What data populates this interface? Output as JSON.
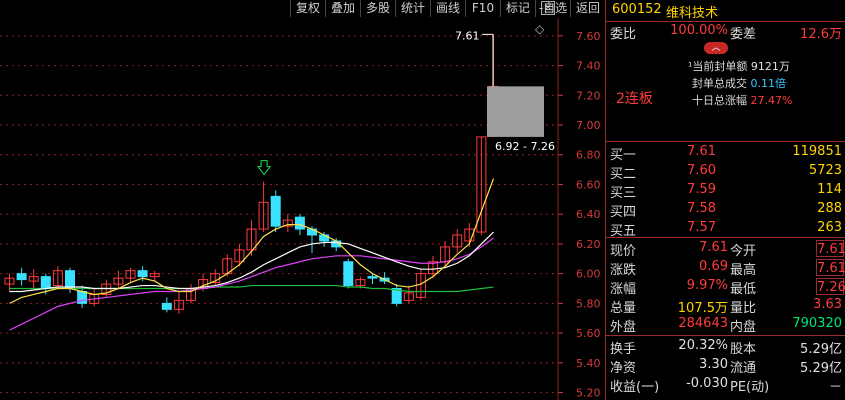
{
  "toolbar": {
    "buttons": [
      "复权",
      "叠加",
      "多股",
      "统计",
      "画线",
      "F10",
      "标记",
      "-自选",
      "返回"
    ],
    "close_symbol": "×"
  },
  "axis": {
    "ticks": [
      "7.60",
      "7.40",
      "7.20",
      "7.00",
      "6.80",
      "6.60",
      "6.40",
      "6.20",
      "6.00",
      "5.80",
      "5.60",
      "5.40",
      "5.20"
    ],
    "range": [
      5.15,
      7.72
    ]
  },
  "annotations": {
    "high_label": "7.61",
    "range_label": "6.92 - 7.26",
    "diamond": "◇"
  },
  "chart_data": {
    "type": "candlestick",
    "candles": [
      {
        "o": 5.93,
        "c": 5.97,
        "h": 6.0,
        "l": 5.88
      },
      {
        "o": 6.0,
        "c": 5.96,
        "h": 6.04,
        "l": 5.92
      },
      {
        "o": 5.95,
        "c": 5.98,
        "h": 6.03,
        "l": 5.9
      },
      {
        "o": 5.98,
        "c": 5.9,
        "h": 6.0,
        "l": 5.86
      },
      {
        "o": 5.92,
        "c": 6.02,
        "h": 6.05,
        "l": 5.9
      },
      {
        "o": 6.02,
        "c": 5.9,
        "h": 6.04,
        "l": 5.87
      },
      {
        "o": 5.88,
        "c": 5.8,
        "h": 5.92,
        "l": 5.77
      },
      {
        "o": 5.8,
        "c": 5.86,
        "h": 5.9,
        "l": 5.78
      },
      {
        "o": 5.86,
        "c": 5.93,
        "h": 5.96,
        "l": 5.84
      },
      {
        "o": 5.93,
        "c": 5.97,
        "h": 6.02,
        "l": 5.9
      },
      {
        "o": 5.97,
        "c": 6.02,
        "h": 6.04,
        "l": 5.94
      },
      {
        "o": 6.02,
        "c": 5.98,
        "h": 6.05,
        "l": 5.95
      },
      {
        "o": 5.98,
        "c": 6.0,
        "h": 6.02,
        "l": 5.95
      },
      {
        "o": 5.8,
        "c": 5.76,
        "h": 5.84,
        "l": 5.74
      },
      {
        "o": 5.76,
        "c": 5.82,
        "h": 5.88,
        "l": 5.73
      },
      {
        "o": 5.82,
        "c": 5.9,
        "h": 5.93,
        "l": 5.8
      },
      {
        "o": 5.9,
        "c": 5.96,
        "h": 6.0,
        "l": 5.88
      },
      {
        "o": 5.94,
        "c": 6.0,
        "h": 6.03,
        "l": 5.92
      },
      {
        "o": 6.0,
        "c": 6.1,
        "h": 6.13,
        "l": 5.98
      },
      {
        "o": 6.08,
        "c": 6.16,
        "h": 6.2,
        "l": 6.05
      },
      {
        "o": 6.16,
        "c": 6.3,
        "h": 6.36,
        "l": 6.12
      },
      {
        "o": 6.3,
        "c": 6.48,
        "h": 6.62,
        "l": 6.28
      },
      {
        "o": 6.52,
        "c": 6.32,
        "h": 6.56,
        "l": 6.28
      },
      {
        "o": 6.32,
        "c": 6.36,
        "h": 6.4,
        "l": 6.28
      },
      {
        "o": 6.38,
        "c": 6.3,
        "h": 6.4,
        "l": 6.26
      },
      {
        "o": 6.3,
        "c": 6.26,
        "h": 6.32,
        "l": 6.14
      },
      {
        "o": 6.26,
        "c": 6.22,
        "h": 6.28,
        "l": 6.18
      },
      {
        "o": 6.22,
        "c": 6.18,
        "h": 6.24,
        "l": 6.15
      },
      {
        "o": 6.08,
        "c": 5.92,
        "h": 6.1,
        "l": 5.9
      },
      {
        "o": 5.92,
        "c": 5.96,
        "h": 5.98,
        "l": 5.9
      },
      {
        "o": 5.98,
        "c": 5.97,
        "h": 6.0,
        "l": 5.93
      },
      {
        "o": 5.97,
        "c": 5.95,
        "h": 6.01,
        "l": 5.93
      },
      {
        "o": 5.9,
        "c": 5.8,
        "h": 5.93,
        "l": 5.78
      },
      {
        "o": 5.82,
        "c": 5.87,
        "h": 5.92,
        "l": 5.8
      },
      {
        "o": 5.84,
        "c": 6.0,
        "h": 6.03,
        "l": 5.82
      },
      {
        "o": 6.0,
        "c": 6.08,
        "h": 6.12,
        "l": 5.97
      },
      {
        "o": 6.08,
        "c": 6.18,
        "h": 6.22,
        "l": 6.05
      },
      {
        "o": 6.18,
        "c": 6.26,
        "h": 6.3,
        "l": 6.14
      },
      {
        "o": 6.22,
        "c": 6.3,
        "h": 6.34,
        "l": 6.18
      },
      {
        "o": 6.28,
        "c": 6.92,
        "h": 6.92,
        "l": 6.26
      },
      {
        "o": 7.26,
        "c": 7.26,
        "h": 7.61,
        "l": 6.92
      }
    ],
    "ma_yellow": [
      5.8,
      5.84,
      5.86,
      5.88,
      5.9,
      5.9,
      5.88,
      5.86,
      5.87,
      5.9,
      5.94,
      5.97,
      5.95,
      5.9,
      5.88,
      5.88,
      5.92,
      5.95,
      6.0,
      6.06,
      6.15,
      6.25,
      6.3,
      6.33,
      6.33,
      6.3,
      6.26,
      6.22,
      6.14,
      6.06,
      6.0,
      5.96,
      5.92,
      5.91,
      5.93,
      5.98,
      6.05,
      6.13,
      6.2,
      6.42,
      6.64
    ],
    "ma_white": [
      5.88,
      5.88,
      5.89,
      5.9,
      5.91,
      5.91,
      5.91,
      5.9,
      5.9,
      5.9,
      5.91,
      5.92,
      5.92,
      5.91,
      5.9,
      5.9,
      5.91,
      5.92,
      5.94,
      5.97,
      6.01,
      6.06,
      6.1,
      6.14,
      6.18,
      6.2,
      6.21,
      6.21,
      6.2,
      6.17,
      6.14,
      6.11,
      6.08,
      6.05,
      6.03,
      6.03,
      6.04,
      6.07,
      6.12,
      6.2,
      6.28
    ],
    "ma_magenta": [
      5.62,
      5.66,
      5.7,
      5.74,
      5.78,
      5.8,
      5.82,
      5.83,
      5.84,
      5.85,
      5.86,
      5.87,
      5.88,
      5.88,
      5.88,
      5.89,
      5.9,
      5.91,
      5.93,
      5.95,
      5.98,
      6.01,
      6.04,
      6.06,
      6.08,
      6.1,
      6.11,
      6.12,
      6.12,
      6.12,
      6.11,
      6.1,
      6.09,
      6.08,
      6.07,
      6.07,
      6.08,
      6.1,
      6.13,
      6.18,
      6.24
    ],
    "ma_green": [
      5.9,
      5.9,
      5.9,
      5.9,
      5.9,
      5.9,
      5.9,
      5.9,
      5.9,
      5.9,
      5.9,
      5.9,
      5.9,
      5.9,
      5.9,
      5.9,
      5.9,
      5.91,
      5.91,
      5.91,
      5.92,
      5.92,
      5.92,
      5.92,
      5.92,
      5.92,
      5.92,
      5.92,
      5.91,
      5.91,
      5.9,
      5.9,
      5.89,
      5.88,
      5.88,
      5.88,
      5.88,
      5.88,
      5.89,
      5.9,
      5.91
    ]
  },
  "stock": {
    "code": "600152",
    "name": "维科技术"
  },
  "quote": {
    "weibi_label": "委比",
    "weibi_val": "100.00%",
    "weicha_label": "委差",
    "weicha_val": "12.6万",
    "seal_amount_label": "当前封单额",
    "seal_amount_val": "9121万",
    "seal_ratio_label": "封单总成交",
    "seal_ratio_val": "0.11倍",
    "ten_day_label": "十日总涨幅",
    "ten_day_val": "27.47%",
    "limit_up_tag": "2连板",
    "buys": [
      {
        "name": "买一",
        "price": "7.61",
        "vol": "119851"
      },
      {
        "name": "买二",
        "price": "7.60",
        "vol": "5723"
      },
      {
        "name": "买三",
        "price": "7.59",
        "vol": "114"
      },
      {
        "name": "买四",
        "price": "7.58",
        "vol": "288"
      },
      {
        "name": "买五",
        "price": "7.57",
        "vol": "263"
      }
    ],
    "stats": [
      {
        "l1": "现价",
        "v1": "7.61",
        "l2": "今开",
        "v2": "7.61"
      },
      {
        "l1": "涨跌",
        "v1": "0.69",
        "l2": "最高",
        "v2": "7.61"
      },
      {
        "l1": "涨幅",
        "v1": "9.97%",
        "l2": "最低",
        "v2": "7.26"
      },
      {
        "l1": "总量",
        "v1": "107.5万",
        "l2": "量比",
        "v2": "3.63"
      },
      {
        "l1": "外盘",
        "v1": "284643",
        "l2": "内盘",
        "v2": "790320"
      }
    ],
    "stats2": [
      {
        "l1": "换手",
        "v1": "20.32%",
        "l2": "股本",
        "v2": "5.29亿"
      },
      {
        "l1": "净资",
        "v1": "3.30",
        "l2": "流通",
        "v2": "5.29亿"
      },
      {
        "l1": "收益(一)",
        "v1": "-0.030",
        "l2": "PE(动)",
        "v2": "－"
      }
    ]
  },
  "colors": {
    "up": "#ff3b3b",
    "down": "#3ae0ff",
    "grid": "#8a1f1f"
  }
}
